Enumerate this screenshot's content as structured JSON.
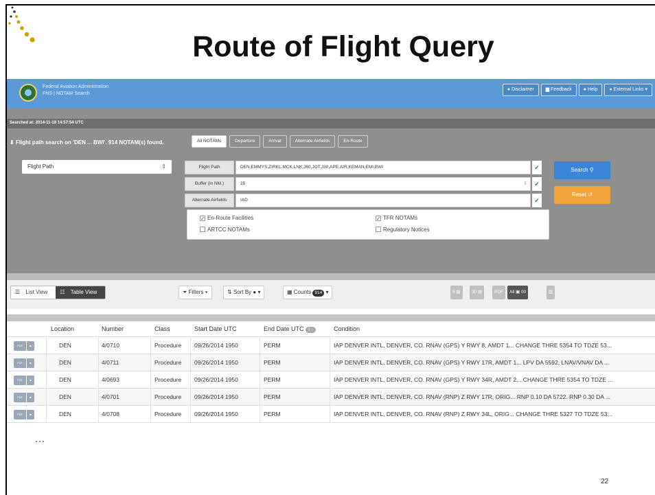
{
  "slide": {
    "title": "Route of Flight Query",
    "ellipsis": "…",
    "page_number": "22"
  },
  "faa": {
    "org_name": "Federal Aviation Administration",
    "app_name": "FNS | NOTAM Search",
    "nav": [
      "Disclaimer",
      "Feedback",
      "Help",
      "External Links"
    ]
  },
  "search": {
    "searched_at": "Searched at: 2014-11-18 14:57:54 UTC",
    "result": "Flight path search on 'DEN ... BWI'. 914 NOTAM(s) found.",
    "tabs": [
      "All NOTAMs",
      "Departure",
      "Arrival",
      "Alternate Airfields",
      "En-Route"
    ],
    "mode": "Flight Path",
    "fields": {
      "flight_path_label": "Flight Path",
      "flight_path_value": "DEN,EMMYS,ZIRKL,MCK,LNK,J60,JOT,J30,APE,AIR,KEMAN,EMI,BWI",
      "buffer_label": "Buffer (in NM.)",
      "buffer_value": "25",
      "alternate_label": "Alternate Airfields",
      "alternate_value": "IAD"
    },
    "options": {
      "enroute": "En-Route Facilities",
      "tfr": "TFR NOTAMs",
      "artcc": "ARTCC NOTAMs",
      "regulatory": "Regulatory Notices"
    },
    "search_button": "Search",
    "reset_button": "Reset"
  },
  "toolbar": {
    "list_view": "List View",
    "table_view": "Table View",
    "filters": "Filters",
    "sort_by": "Sort By",
    "counts": "Counts",
    "counts_badge": "914",
    "icon_a": "8",
    "icon_b": "30",
    "pdf": "PDF",
    "all": "All",
    "num": "00"
  },
  "table": {
    "headers": [
      "Location",
      "Number",
      "Class",
      "Start Date UTC",
      "End Date UTC",
      "Condition"
    ],
    "end_tag": "1 ↓",
    "rows": [
      {
        "location": "DEN",
        "number": "4/0710",
        "class": "Procedure",
        "start": "09/26/2014 1950",
        "end": "PERM",
        "condition": "IAP DENVER INTL, DENVER, CO. RNAV (GPS) Y RWY 8, AMDT 1... CHANGE THRE 5354 TO TDZE 53..."
      },
      {
        "location": "DEN",
        "number": "4/0711",
        "class": "Procedure",
        "start": "09/26/2014 1950",
        "end": "PERM",
        "condition": "IAP DENVER INTL, DENVER, CO. RNAV (GPS) Y RWY 17R, AMDT 1... LPV DA 5592. LNAV/VNAV DA ..."
      },
      {
        "location": "DEN",
        "number": "4/0693",
        "class": "Procedure",
        "start": "09/26/2014 1950",
        "end": "PERM",
        "condition": "IAP DENVER INTL, DENVER, CO. RNAV (GPS) Y RWY 34R, AMDT 2... CHANGE THRE 5354 TO TDZE ..."
      },
      {
        "location": "DEN",
        "number": "4/0701",
        "class": "Procedure",
        "start": "09/26/2014 1950",
        "end": "PERM",
        "condition": "IAP DENVER INTL, DENVER, CO. RNAV (RNP) Z RWY 17R, ORIG... RNP 0.10 DA 5722. RNP 0.30 DA ..."
      },
      {
        "location": "DEN",
        "number": "4/0708",
        "class": "Procedure",
        "start": "09/26/2014 1950",
        "end": "PERM",
        "condition": "IAP DENVER INTL, DENVER, CO. RNAV (RNP) Z RWY 34L, ORIG... CHANGE THRE 5327 TO TDZE 53..."
      }
    ]
  }
}
